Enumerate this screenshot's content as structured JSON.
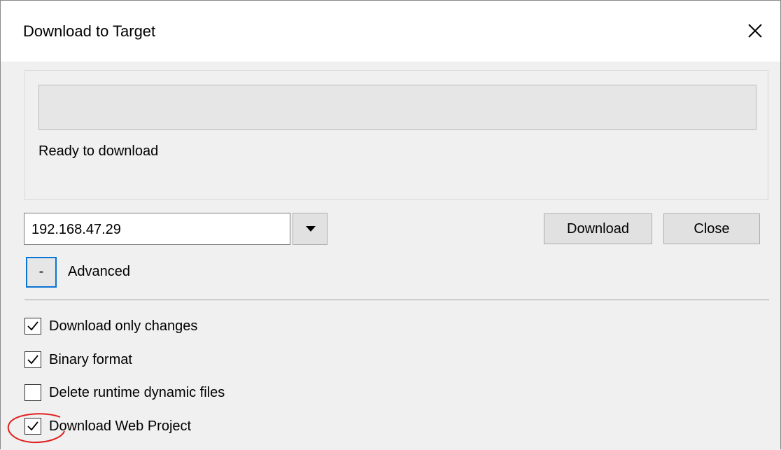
{
  "dialog": {
    "title": "Download to Target"
  },
  "status": {
    "progress": 0,
    "message": "Ready to download"
  },
  "target": {
    "address": "192.168.47.29"
  },
  "buttons": {
    "download": "Download",
    "close": "Close"
  },
  "advanced": {
    "toggle_symbol": "-",
    "label": "Advanced"
  },
  "options": [
    {
      "label": "Download only changes",
      "checked": true
    },
    {
      "label": "Binary format",
      "checked": true
    },
    {
      "label": "Delete runtime dynamic files",
      "checked": false
    },
    {
      "label": "Download Web Project",
      "checked": true
    }
  ],
  "colors": {
    "background": "#f0f0f0",
    "focus_accent": "#0a74d4",
    "annotation": "#e02020"
  },
  "icons": {
    "close": "close-icon",
    "dropdown": "chevron-down-icon",
    "checkmark": "checkmark-icon"
  }
}
